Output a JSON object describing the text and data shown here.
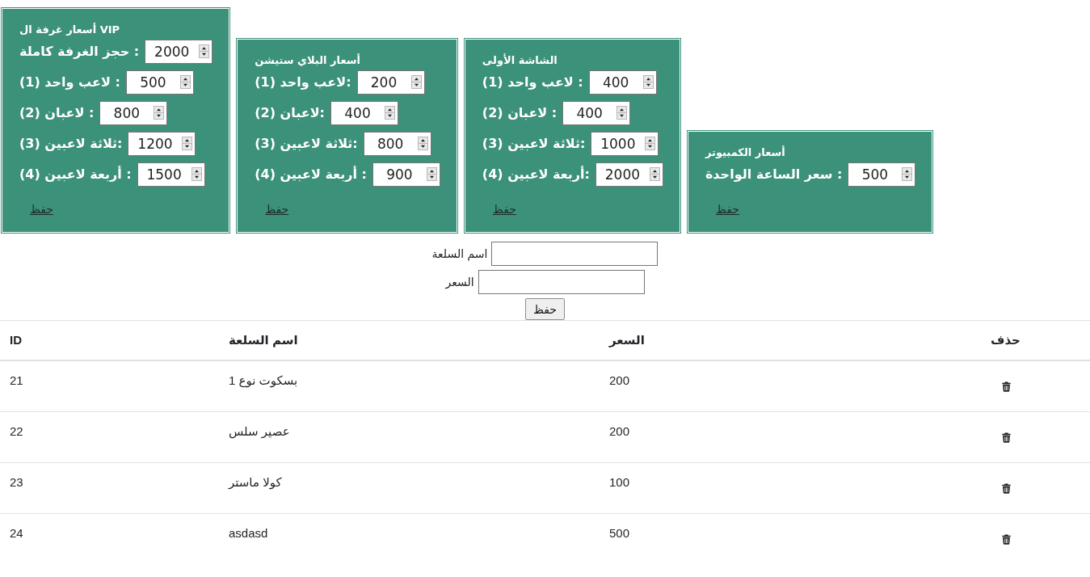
{
  "price_cards": [
    {
      "title": "أسعار الكمبيوتر",
      "fields": [
        {
          "label": "سعر الساعة الواحدة :",
          "value": "500"
        }
      ],
      "save_link": "حفظ"
    },
    {
      "title": "الشاشة الأولى",
      "fields": [
        {
          "label": "لاعب واحد (1) :",
          "value": "400"
        },
        {
          "label": "لاعبان (2) :",
          "value": "400"
        },
        {
          "label": "ثلاثة لاعبين (3):",
          "value": "1000"
        },
        {
          "label": "أربعة لاعبين (4):",
          "value": "2000"
        }
      ],
      "save_link": "حفظ"
    },
    {
      "title": "أسعار البلاي ستيشن",
      "fields": [
        {
          "label": "لاعب واحد (1):",
          "value": "200"
        },
        {
          "label": "لاعبان (2):",
          "value": "400"
        },
        {
          "label": "ثلاثة لاعبين (3):",
          "value": "800"
        },
        {
          "label": "أربعة لاعبين (4) :",
          "value": "900"
        }
      ],
      "save_link": "حفظ"
    },
    {
      "title": "أسعار غرفة ال VIP",
      "fields": [
        {
          "label": "حجز الغرفة كاملة :",
          "value": "2000"
        },
        {
          "label": "لاعب واحد (1) :",
          "value": "500"
        },
        {
          "label": "لاعبان (2) :",
          "value": "800"
        },
        {
          "label": "ثلاثة لاعبين (3):",
          "value": "1200"
        },
        {
          "label": "أربعة لاعبين (4) :",
          "value": "1500"
        }
      ],
      "save_link": "حفظ"
    }
  ],
  "product_form": {
    "fields": [
      {
        "label": "اسم السلعة"
      },
      {
        "label": "السعر"
      }
    ],
    "submit_button": "حفظ"
  },
  "table": {
    "columns": [
      {
        "label": "حذف",
        "kind": "action"
      },
      {
        "label": "السعر",
        "kind": "text"
      },
      {
        "label": "اسم السلعة",
        "kind": "text"
      },
      {
        "label": "ID",
        "kind": "text"
      }
    ],
    "rows": [
      {
        "cells": [
          "",
          "200",
          "بسكوت نوع 1",
          "21"
        ]
      },
      {
        "cells": [
          "",
          "200",
          "عصير سلس",
          "22"
        ]
      },
      {
        "cells": [
          "",
          "100",
          "كولا ماستر",
          "23"
        ]
      },
      {
        "cells": [
          "",
          "500",
          "asdasd",
          "24"
        ]
      }
    ]
  }
}
